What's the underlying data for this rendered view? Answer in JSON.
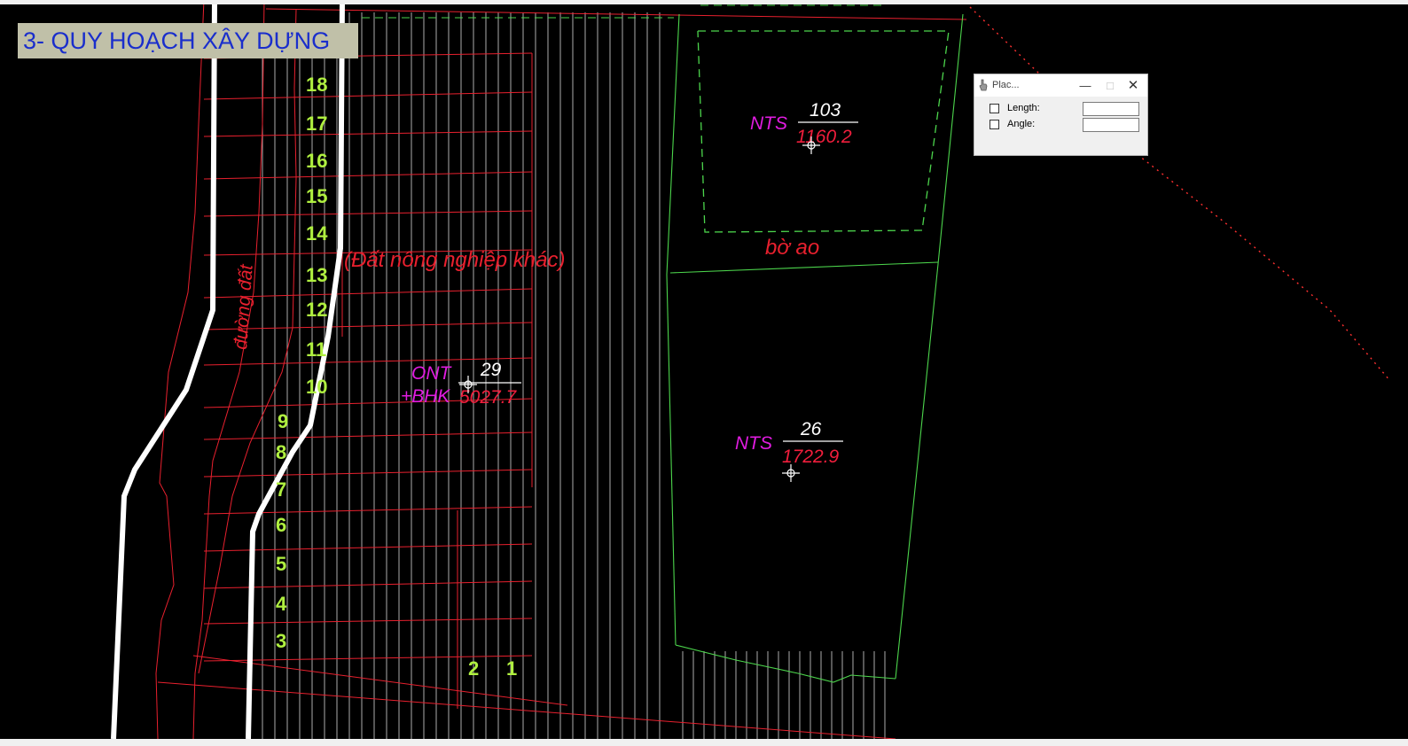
{
  "banner": {
    "title": "3- QUY HOẠCH XÂY DỰNG"
  },
  "road_label": "đường đất",
  "agri_label": "(Đất nông nghiệp khác)",
  "pond_bank_label": "bờ ao",
  "lot_numbers": [
    "18",
    "17",
    "16",
    "15",
    "14",
    "13",
    "12",
    "11",
    "10",
    "9",
    "8",
    "7",
    "6",
    "5",
    "4",
    "3",
    "2",
    "1"
  ],
  "parcels": [
    {
      "type": "NTS",
      "number": "103",
      "area": "1160.2"
    },
    {
      "type": "ONT",
      "type_line2": "+BHK",
      "number": "29",
      "area": "5027.7"
    },
    {
      "type": "NTS",
      "number": "26",
      "area": "1722.9"
    }
  ],
  "place_dialog": {
    "title": "Plac...",
    "length_label": "Length:",
    "angle_label": "Angle:",
    "length_value": "",
    "angle_value": "",
    "length_checked": false,
    "angle_checked": false
  },
  "colors": {
    "parcel_line": "#e8202e",
    "hatch_line": "#d8d8d8",
    "pond_line": "#4cd54c",
    "lot_number": "#b0f040",
    "type_code": "#e01ce0",
    "area_text": "#f01e3c",
    "banner_text": "#1a2ecc",
    "background": "#000000"
  }
}
